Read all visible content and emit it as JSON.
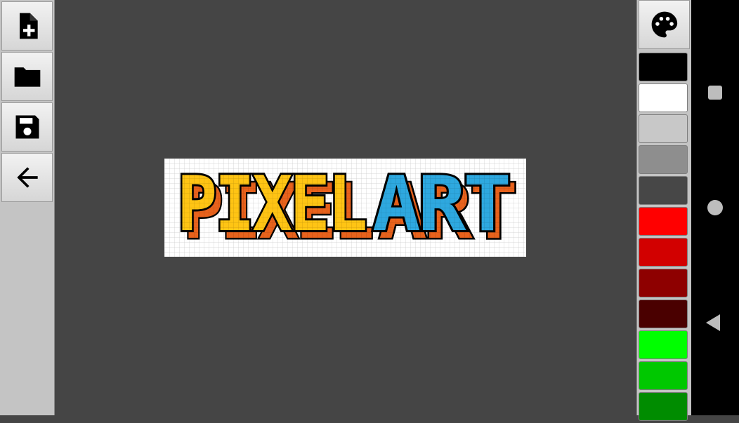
{
  "toolbar": {
    "buttons": [
      {
        "name": "new-file",
        "icon": "new-file-icon"
      },
      {
        "name": "open-folder",
        "icon": "folder-icon"
      },
      {
        "name": "save",
        "icon": "save-icon"
      },
      {
        "name": "back",
        "icon": "arrow-back-icon"
      }
    ]
  },
  "canvas": {
    "text_word_1": "PIXEL",
    "text_word_2": "ART",
    "colors": {
      "word1_fill": "#ffc414",
      "word2_fill": "#2ea8df",
      "shadow": "#e8621c",
      "outline": "#000000",
      "background": "#ffffff"
    }
  },
  "palette": {
    "icon": "palette-icon",
    "swatches": [
      "#000000",
      "#ffffff",
      "#c8c8c8",
      "#8e8e8e",
      "#474747",
      "#ff0000",
      "#d20000",
      "#8e0000",
      "#4a0000",
      "#00ff00",
      "#00c800",
      "#008c00"
    ]
  },
  "system_nav": {
    "buttons": [
      "recents",
      "home",
      "back"
    ]
  }
}
